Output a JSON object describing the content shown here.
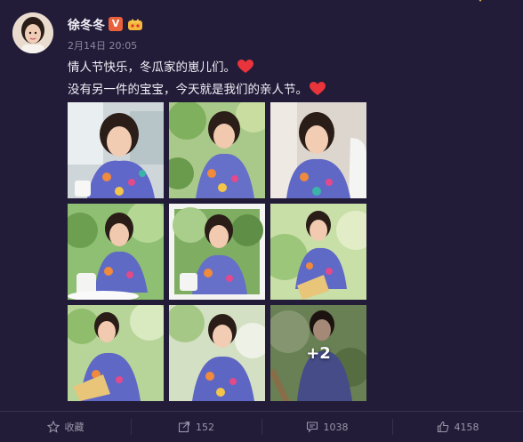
{
  "post": {
    "author": "徐冬冬",
    "verified_badge": "V",
    "timestamp": "2月14日 20:05",
    "text_line1": "情人节快乐，冬瓜家的崽儿们。",
    "text_line2": "没有另一件的宝宝，今天就是我们的亲人节。",
    "more_photos_label": "+2"
  },
  "photos": [
    {
      "name": "photo-1"
    },
    {
      "name": "photo-2"
    },
    {
      "name": "photo-3"
    },
    {
      "name": "photo-4"
    },
    {
      "name": "photo-5"
    },
    {
      "name": "photo-6"
    },
    {
      "name": "photo-7"
    },
    {
      "name": "photo-8"
    },
    {
      "name": "photo-9"
    }
  ],
  "actions": {
    "favorite_label": "收藏",
    "share_count": "152",
    "comment_count": "1038",
    "like_count": "4158"
  },
  "colors": {
    "background": "#231c38",
    "heart": "#e8343a",
    "badge": "#e8613a"
  }
}
